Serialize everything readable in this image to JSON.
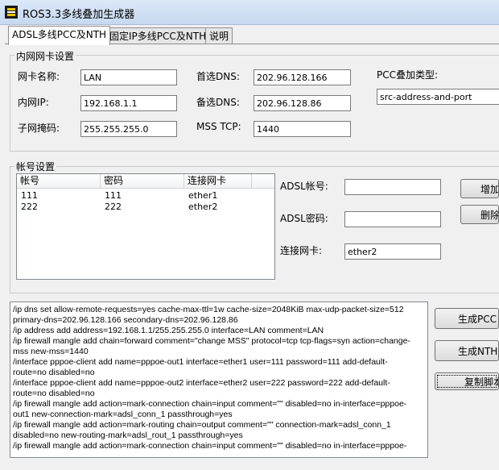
{
  "window": {
    "title": "ROS3.3多线叠加生成器"
  },
  "tabs": [
    {
      "label": "ADSL多线PCC及NTH",
      "active": true
    },
    {
      "label": "固定IP多线PCC及NTH",
      "active": false
    },
    {
      "label": "说明",
      "active": false
    }
  ],
  "lan_group": {
    "title": "内网网卡设置",
    "nic_name_label": "网卡名称:",
    "nic_name_value": "LAN",
    "lan_ip_label": "内网IP:",
    "lan_ip_value": "192.168.1.1",
    "subnet_label": "子网掩码:",
    "subnet_value": "255.255.255.0",
    "dns1_label": "首选DNS:",
    "dns1_value": "202.96.128.166",
    "dns2_label": "备选DNS:",
    "dns2_value": "202.96.128.86",
    "mss_label": "MSS TCP:",
    "mss_value": "1440",
    "pcc_type_label": "PCC叠加类型:",
    "pcc_type_value": "src-address-and-port"
  },
  "account_group": {
    "title": "帐号设置",
    "columns": [
      "帐号",
      "密码",
      "连接网卡"
    ],
    "rows": [
      [
        "111",
        "111",
        "ether1"
      ],
      [
        "222",
        "222",
        "ether2"
      ]
    ],
    "adsl_account_label": "ADSL帐号:",
    "adsl_account_value": "",
    "adsl_password_label": "ADSL密码:",
    "adsl_password_value": "",
    "connect_nic_label": "连接网卡:",
    "connect_nic_value": "ether2",
    "add_button": "增加",
    "delete_button": "删除"
  },
  "actions": {
    "generate_pcc": "生成PCC",
    "generate_nth": "生成NTH",
    "copy_script": "复制脚本"
  },
  "output_lines": [
    "/ip dns set allow-remote-requests=yes cache-max-ttl=1w cache-size=2048KiB max-udp-packet-size=512",
    "primary-dns=202.96.128.166 secondary-dns=202.96.128.86",
    "/ip address add address=192.168.1.1/255.255.255.0 interface=LAN comment=LAN",
    "/ip firewall mangle add chain=forward comment=\"change MSS\" protocol=tcp tcp-flags=syn action=change-",
    "mss new-mss=1440",
    "/interface pppoe-client add name=pppoe-out1 interface=ether1 user=111 password=111 add-default-",
    "route=no disabled=no",
    "/interface pppoe-client add name=pppoe-out2 interface=ether2 user=222 password=222 add-default-",
    "route=no disabled=no",
    "/ip firewall mangle add action=mark-connection chain=input comment=\"\" disabled=no in-interface=pppoe-",
    "out1 new-connection-mark=adsl_conn_1 passthrough=yes",
    "/ip firewall mangle add action=mark-routing chain=output comment=\"\" connection-mark=adsl_conn_1",
    "disabled=no new-routing-mark=adsl_rout_1 passthrough=yes",
    "/ip firewall mangle add action=mark-connection chain=input comment=\"\" disabled=no in-interface=pppoe-"
  ]
}
